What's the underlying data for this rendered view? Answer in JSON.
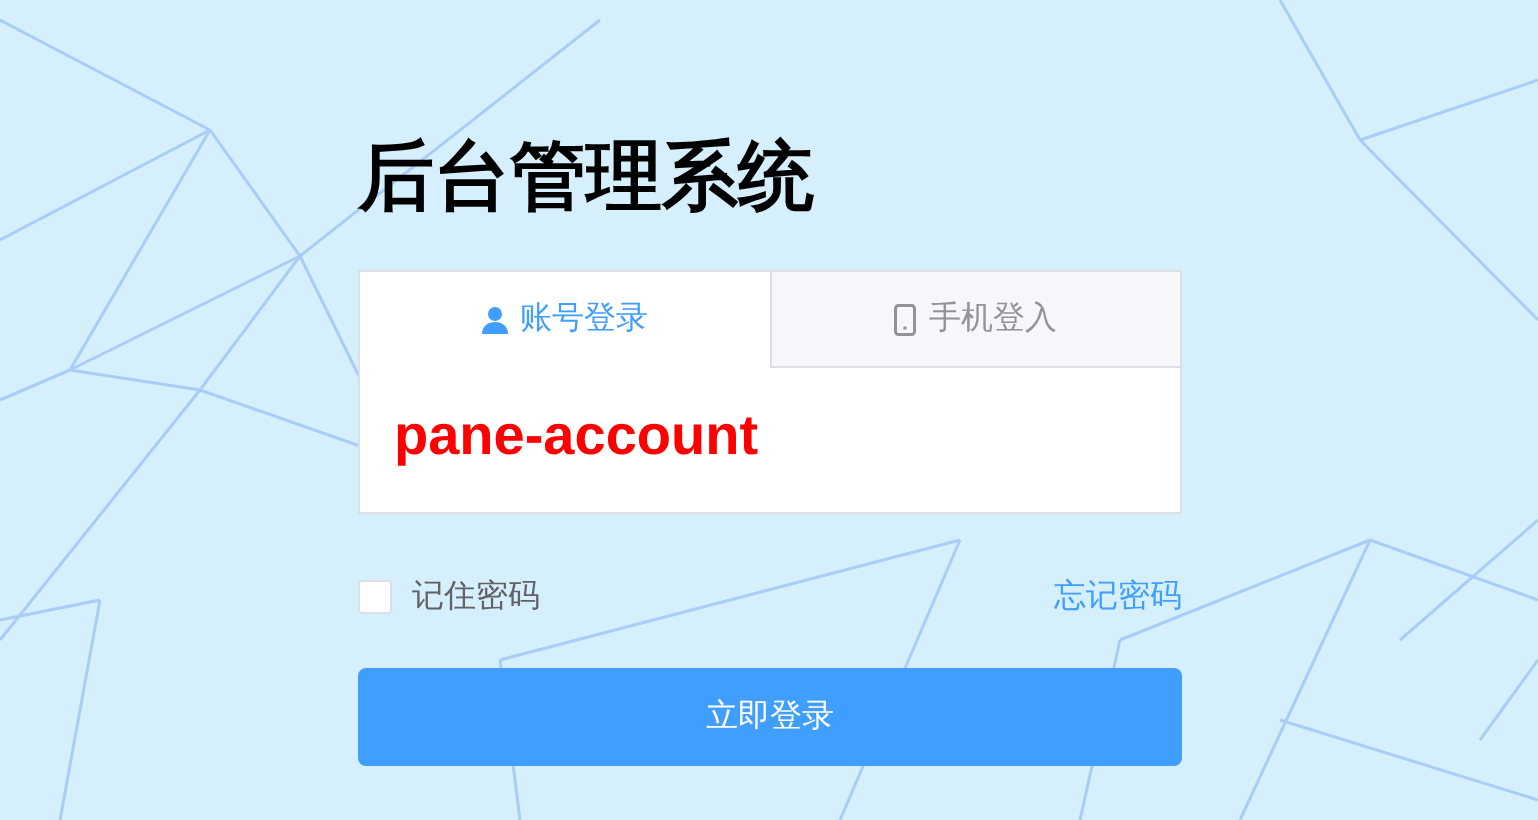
{
  "title": "后台管理系统",
  "tabs": [
    {
      "kind": "account",
      "label": "账号登录",
      "selected": true
    },
    {
      "kind": "phone",
      "label": "手机登入",
      "selected": false
    }
  ],
  "pane": {
    "text": "pane-account"
  },
  "remember": {
    "label": "记住密码",
    "checked": false
  },
  "forgot_link": "忘记密码",
  "login_button": "立即登录"
}
